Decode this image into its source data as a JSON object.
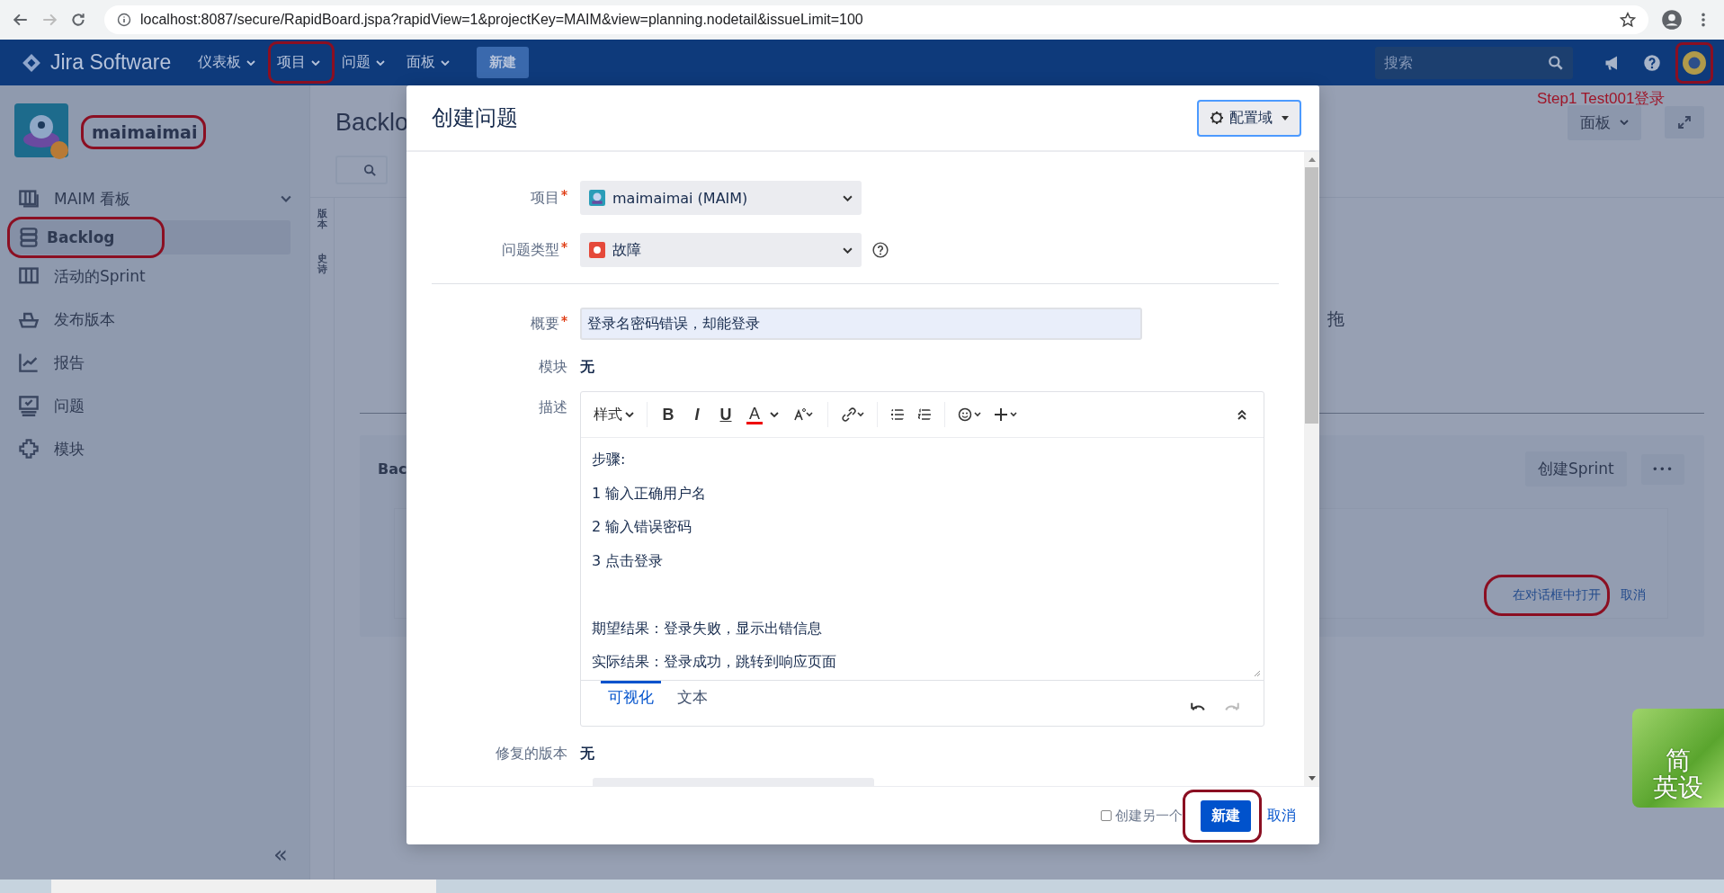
{
  "browser": {
    "url": "localhost:8087/secure/RapidBoard.jspa?rapidView=1&projectKey=MAIM&view=planning.nodetail&issueLimit=100"
  },
  "nav": {
    "logo": "Jira Software",
    "menus": [
      {
        "label": "仪表板",
        "circled": false
      },
      {
        "label": "项目",
        "circled": true
      },
      {
        "label": "问题",
        "circled": false
      },
      {
        "label": "面板",
        "circled": false
      }
    ],
    "create": "新建",
    "search": {
      "placeholder": "搜索"
    },
    "avatar": {
      "circled": true
    }
  },
  "annotation": {
    "text": "Step1 Test001登录"
  },
  "sidebar": {
    "project": {
      "name": "maimaimai",
      "circled": true
    },
    "items": [
      {
        "label": "MAIM 看板",
        "kind": "switcher",
        "selected": false,
        "circled": false
      },
      {
        "label": "Backlog",
        "kind": "link",
        "selected": true,
        "circled": true
      },
      {
        "label": "活动的Sprint",
        "kind": "link",
        "selected": false,
        "circled": false
      },
      {
        "label": "发布版本",
        "kind": "link",
        "selected": false,
        "circled": false
      },
      {
        "label": "报告",
        "kind": "link",
        "selected": false,
        "circled": false
      },
      {
        "label": "问题",
        "kind": "link",
        "selected": false,
        "circled": false
      },
      {
        "label": "模块",
        "kind": "link",
        "selected": false,
        "circled": false
      }
    ],
    "collapse": "«"
  },
  "board": {
    "title": "Backlo",
    "side_tabs": [
      "版本",
      "史诗"
    ],
    "fragment": "拖",
    "board_button": "面板",
    "section_title": "Bac",
    "create_sprint": "创建Sprint",
    "more": "•••",
    "open_in_dialog": {
      "label": "在对话框中打开",
      "circled": true
    },
    "cancel": "取消"
  },
  "dialog": {
    "title": "创建问题",
    "config_button": "配置域",
    "top_fields": [
      {
        "label": "项目",
        "required": true,
        "kind": "select",
        "value": "maimaimai (MAIM)",
        "help": false
      },
      {
        "label": "问题类型",
        "required": true,
        "kind": "select",
        "value": "故障",
        "help": true
      }
    ],
    "fields": [
      {
        "label": "概要",
        "required": true,
        "kind": "text",
        "value": "登录名密码错误，却能登录"
      },
      {
        "label": "模块",
        "required": false,
        "kind": "static",
        "value": "无"
      },
      {
        "label": "描述",
        "required": false,
        "kind": "editor"
      },
      {
        "label": "修复的版本",
        "required": false,
        "kind": "static",
        "value": "无"
      }
    ],
    "editor": {
      "style_menu": "样式",
      "format_buttons": [
        {
          "label": "B",
          "kind": "bold"
        },
        {
          "label": "I",
          "kind": "italic"
        },
        {
          "label": "U",
          "kind": "underline"
        },
        {
          "label": "A",
          "kind": "color"
        }
      ],
      "paragraphs": [
        [
          "步骤:",
          "1 输入正确用户名",
          "2 输入错误密码",
          "3 点击登录"
        ],
        [
          "期望结果：登录失败，显示出错信息",
          "实际结果：登录成功，跳转到响应页面"
        ]
      ],
      "tabs": [
        {
          "label": "可视化",
          "selected": true
        },
        {
          "label": "文本",
          "selected": false
        }
      ]
    },
    "footer": {
      "create_another": {
        "label": "创建另一个",
        "checked": false
      },
      "submit": {
        "label": "新建",
        "circled": true
      },
      "cancel": "取消"
    }
  },
  "ime": {
    "lines": [
      "简",
      "英设"
    ]
  }
}
